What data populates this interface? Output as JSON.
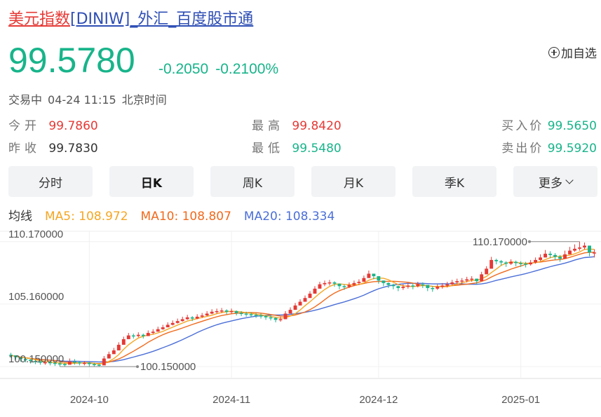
{
  "header": {
    "name": "美元指数",
    "rest": "[DINIW]_外汇_百度股市通",
    "price": "99.5780",
    "change": "-0.2050",
    "change_pct": "-0.2100%",
    "add_label": "加自选"
  },
  "status": {
    "state": "交易中",
    "datetime": "04-24 11:15",
    "tz": "北京时间"
  },
  "quote": {
    "open_label": "今开",
    "open": "99.7860",
    "prev_label": "昨收",
    "prev": "99.7830",
    "high_label": "最高",
    "high": "99.8420",
    "low_label": "最低",
    "low": "99.5480",
    "bid_label": "买入价",
    "bid": "99.5650",
    "ask_label": "卖出价",
    "ask": "99.5920"
  },
  "tabs": [
    "分时",
    "日K",
    "周K",
    "月K",
    "季K",
    "更多"
  ],
  "active_tab": "日K",
  "ma": {
    "label": "均线",
    "ma5": "MA5: 108.972",
    "ma10": "MA10: 108.807",
    "ma20": "MA20: 108.334"
  },
  "colors": {
    "up": "#e53935",
    "down": "#18b48a",
    "ma5": "#f5a623",
    "ma10": "#f06a1d",
    "ma20": "#4b6fd8"
  },
  "chart_data": {
    "type": "candlestick",
    "y_labels": [
      "110.170000",
      "105.160000",
      "100.150000"
    ],
    "ylim": [
      99.2,
      111.0
    ],
    "x_labels": [
      "2024-10",
      "2024-11",
      "2024-12",
      "2025-01"
    ],
    "max_annotation": "110.170000",
    "min_annotation": "100.150000",
    "closes": [
      101.05,
      100.9,
      100.75,
      100.7,
      100.6,
      100.55,
      100.5,
      100.5,
      100.45,
      100.4,
      100.35,
      100.3,
      100.55,
      100.5,
      100.45,
      100.45,
      100.35,
      100.3,
      100.25,
      100.8,
      101.15,
      101.45,
      101.9,
      102.35,
      102.65,
      102.6,
      102.7,
      102.6,
      102.85,
      102.95,
      103.15,
      103.3,
      103.5,
      103.65,
      103.8,
      103.95,
      104.1,
      104.0,
      104.15,
      104.25,
      104.4,
      104.55,
      104.6,
      104.65,
      104.55,
      104.6,
      104.45,
      104.4,
      104.35,
      104.3,
      104.25,
      104.2,
      104.1,
      104.05,
      103.9,
      103.95,
      104.4,
      104.7,
      105.05,
      105.35,
      105.65,
      106.0,
      106.4,
      106.75,
      106.85,
      106.9,
      106.8,
      106.6,
      106.55,
      106.7,
      106.85,
      106.95,
      107.25,
      107.6,
      107.4,
      107.05,
      106.85,
      106.7,
      106.6,
      106.45,
      106.55,
      106.65,
      106.6,
      106.75,
      106.7,
      106.45,
      106.4,
      106.55,
      106.65,
      106.75,
      106.9,
      107.0,
      107.05,
      107.15,
      107.2,
      107.0,
      107.55,
      108.0,
      108.7,
      108.6,
      108.5,
      108.4,
      108.55,
      108.45,
      108.4,
      108.35,
      108.5,
      108.7,
      108.9,
      109.2,
      109.1,
      108.95,
      108.8,
      109.15,
      109.45,
      109.6,
      109.7,
      109.85,
      109.3,
      109.3
    ],
    "highs": [
      101.25,
      101.05,
      100.9,
      100.85,
      100.75,
      100.7,
      100.65,
      100.65,
      100.6,
      100.55,
      100.5,
      100.45,
      100.8,
      100.75,
      100.6,
      100.6,
      100.5,
      100.45,
      100.35,
      101.0,
      101.35,
      101.65,
      102.1,
      102.55,
      102.85,
      102.8,
      102.9,
      102.8,
      103.05,
      103.15,
      103.35,
      103.5,
      103.7,
      103.85,
      104.0,
      104.15,
      104.3,
      104.2,
      104.35,
      104.45,
      104.6,
      104.75,
      104.8,
      104.85,
      104.75,
      104.8,
      104.65,
      104.6,
      104.55,
      104.5,
      104.45,
      104.4,
      104.3,
      104.25,
      104.1,
      104.15,
      104.6,
      104.9,
      105.25,
      105.55,
      105.85,
      106.2,
      106.6,
      106.95,
      107.05,
      107.1,
      107.0,
      106.8,
      106.75,
      106.9,
      107.05,
      107.15,
      107.45,
      107.85,
      107.6,
      107.25,
      107.05,
      106.9,
      106.8,
      106.65,
      106.75,
      106.85,
      106.8,
      106.95,
      106.9,
      106.65,
      106.6,
      106.75,
      106.85,
      106.95,
      107.1,
      107.2,
      107.25,
      107.35,
      107.4,
      107.2,
      107.75,
      108.2,
      108.95,
      108.8,
      108.7,
      108.6,
      108.75,
      108.65,
      108.6,
      108.55,
      108.7,
      108.9,
      109.15,
      109.5,
      109.4,
      109.25,
      109.1,
      109.45,
      109.75,
      109.95,
      110.17,
      110.1,
      109.6,
      109.55
    ],
    "lows": [
      100.85,
      100.7,
      100.55,
      100.5,
      100.4,
      100.35,
      100.3,
      100.3,
      100.25,
      100.2,
      100.15,
      100.15,
      100.35,
      100.3,
      100.25,
      100.25,
      100.15,
      100.15,
      100.15,
      100.4,
      100.95,
      101.25,
      101.7,
      102.15,
      102.45,
      102.4,
      102.5,
      102.4,
      102.65,
      102.75,
      102.95,
      103.1,
      103.3,
      103.45,
      103.6,
      103.75,
      103.9,
      103.8,
      103.95,
      104.05,
      104.2,
      104.35,
      104.4,
      104.45,
      104.35,
      104.4,
      104.25,
      104.2,
      104.15,
      104.1,
      104.05,
      104.0,
      103.9,
      103.85,
      103.7,
      103.75,
      104.0,
      104.4,
      104.8,
      105.1,
      105.4,
      105.75,
      106.1,
      106.5,
      106.6,
      106.65,
      106.55,
      106.35,
      106.3,
      106.45,
      106.6,
      106.7,
      107.0,
      107.3,
      107.15,
      106.8,
      106.6,
      106.45,
      106.35,
      106.2,
      106.3,
      106.4,
      106.35,
      106.5,
      106.45,
      106.2,
      106.15,
      106.3,
      106.4,
      106.5,
      106.65,
      106.75,
      106.8,
      106.9,
      106.95,
      106.75,
      107.3,
      107.75,
      108.4,
      108.35,
      108.25,
      108.15,
      108.3,
      108.2,
      108.15,
      108.1,
      108.25,
      108.4,
      108.6,
      108.9,
      108.85,
      108.7,
      108.55,
      108.85,
      109.15,
      109.35,
      109.45,
      109.55,
      109.0,
      108.9
    ]
  }
}
